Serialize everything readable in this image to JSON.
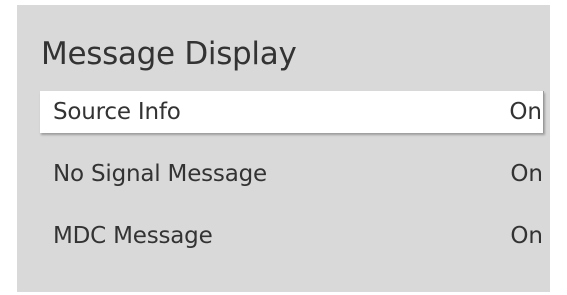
{
  "menu": {
    "title": "Message Display",
    "items": [
      {
        "label": "Source Info",
        "value": "On",
        "selected": true
      },
      {
        "label": "No Signal Message",
        "value": "On",
        "selected": false
      },
      {
        "label": "MDC Message",
        "value": "On",
        "selected": false
      }
    ]
  },
  "colors": {
    "panel_background": "#d9d9d9",
    "selected_background": "#ffffff",
    "text": "#333333"
  }
}
